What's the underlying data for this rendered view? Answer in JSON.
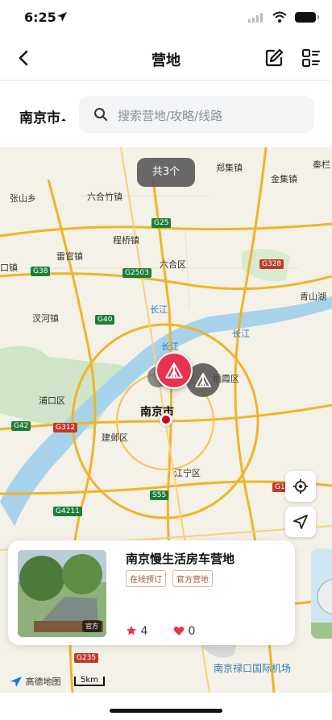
{
  "status": {
    "time": "6:25"
  },
  "header": {
    "title": "营地"
  },
  "search": {
    "city": "南京市",
    "placeholder": "搜索营地/攻略/线路"
  },
  "map": {
    "count_label": "共3个",
    "city_label": "南京市",
    "labels": {
      "zhangshan": "张山乡",
      "liuhe": "六合竹镇",
      "zhengji": "郑集镇",
      "jinji": "金集镇",
      "qinhe": "秦栏",
      "chengqiao": "程桥镇",
      "leiguan": "雷官镇",
      "liuhequ": "六合区",
      "kou": "口镇",
      "qingshanhu": "青山湖",
      "tanghe": "汊河镇",
      "changjiang1": "长江",
      "changjiang2": "长江",
      "changjiang3": "长江",
      "qixia": "栖霞区",
      "pukou": "浦口区",
      "jianye": "建邺区",
      "jiangning": "江宁区",
      "airport": "南京禄口国际机场"
    },
    "shields": {
      "g25": "G25",
      "g38": "G38",
      "g2503": "G2503",
      "g328": "G328",
      "g40": "G40",
      "g42": "G42",
      "g312": "G312",
      "s55": "S55",
      "g10": "G10",
      "g4211": "G4211",
      "g235": "G235"
    },
    "logo": "高德地图",
    "scale": "5km"
  },
  "card": {
    "name": "南京慢生活房车营地",
    "tags": [
      "在线预订",
      "官方营地"
    ],
    "photo_badge": "官方",
    "stars": "4",
    "likes": "0"
  },
  "colors": {
    "accent": "#e8334e",
    "road": "#f4b400",
    "water": "#a7d3ea"
  }
}
